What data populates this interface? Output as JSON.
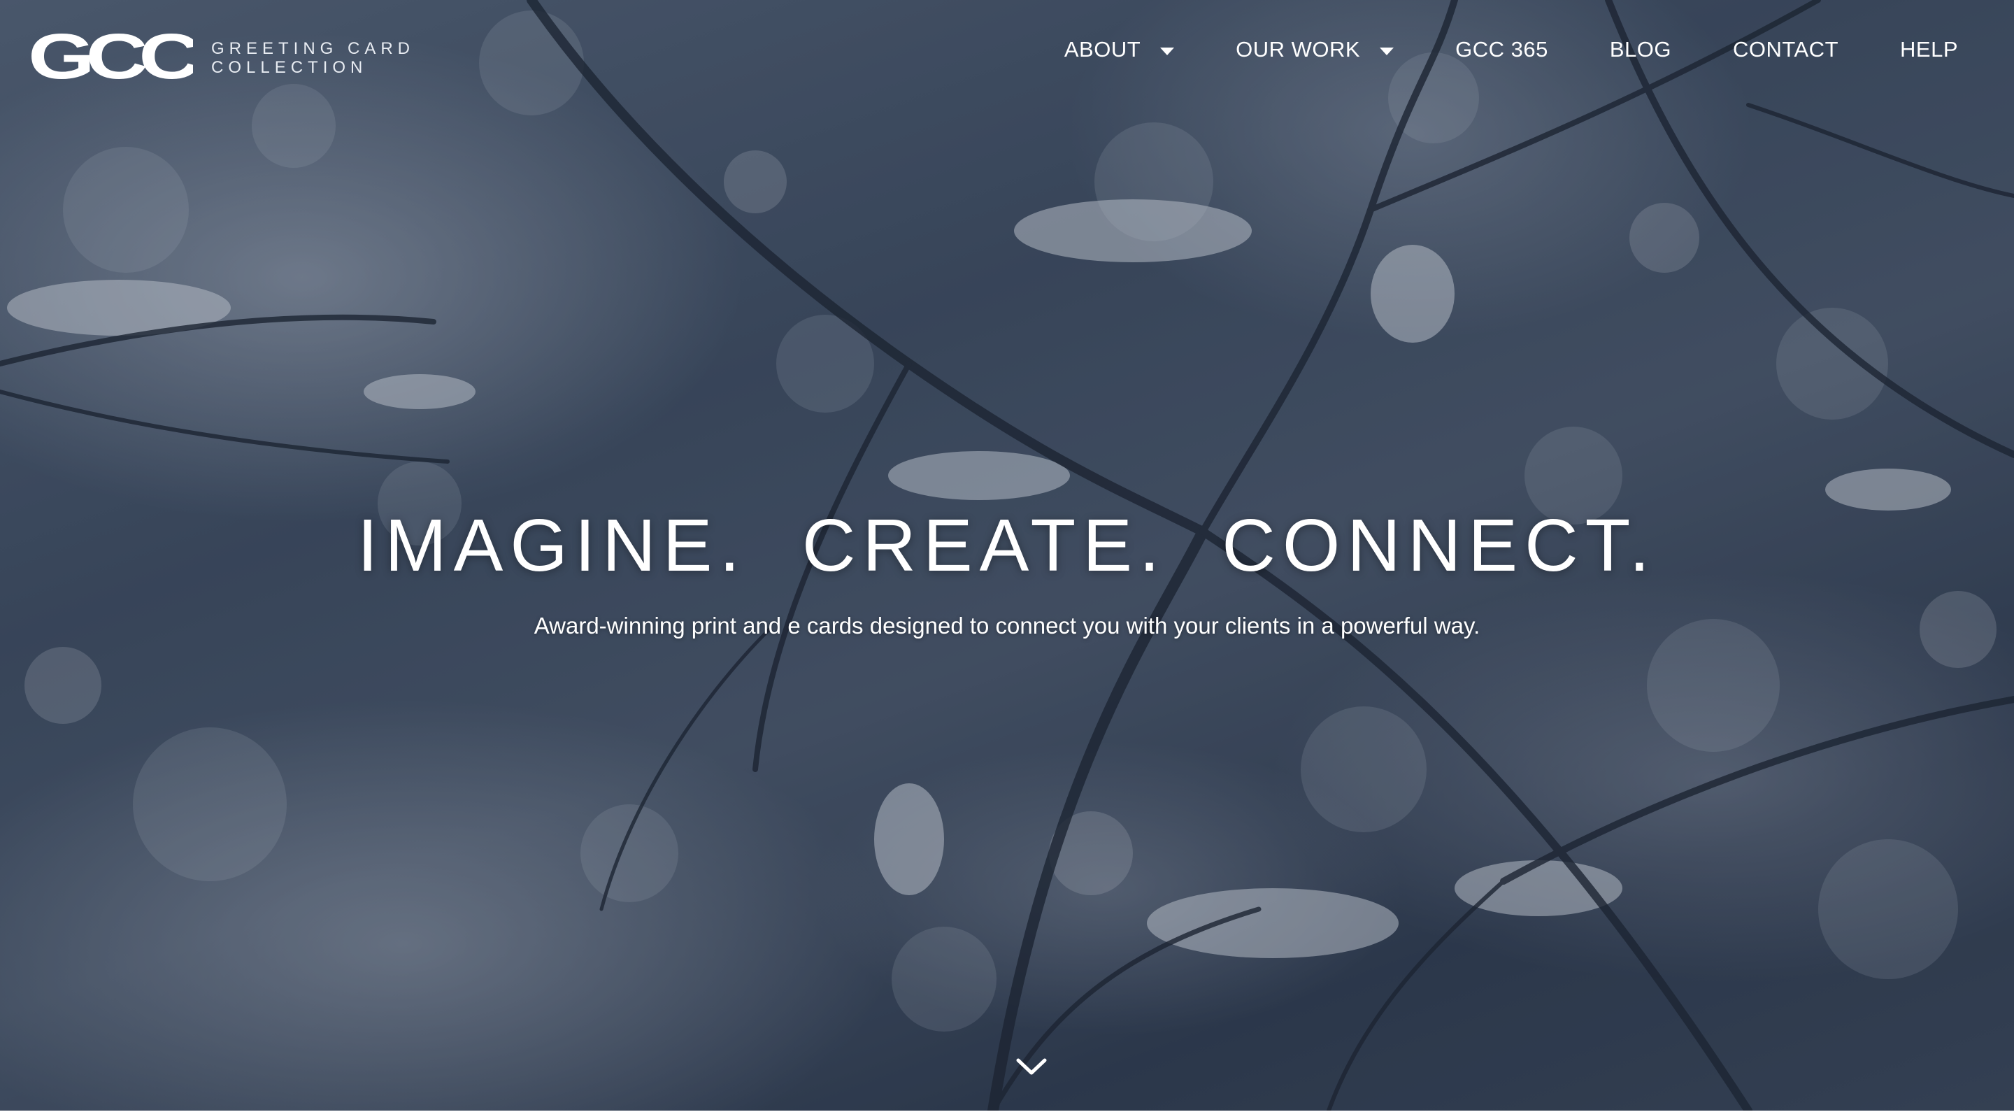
{
  "brand": {
    "mark": "GCC",
    "name_line1": "GREETING CARD",
    "name_line2": "COLLECTION"
  },
  "nav": {
    "items": [
      {
        "label": "ABOUT",
        "has_dropdown": true
      },
      {
        "label": "OUR WORK",
        "has_dropdown": true
      },
      {
        "label": "GCC 365",
        "has_dropdown": false
      },
      {
        "label": "BLOG",
        "has_dropdown": false
      },
      {
        "label": "CONTACT",
        "has_dropdown": false
      },
      {
        "label": "HELP",
        "has_dropdown": false
      }
    ]
  },
  "hero": {
    "headline_words": [
      "IMAGINE.",
      "CREATE.",
      "CONNECT."
    ],
    "subheadline": "Award-winning print and e cards designed to connect you with your clients in a powerful way.",
    "background_description_icon": "snowy-branches-image",
    "scroll_icon": "chevron-down-icon"
  },
  "colors": {
    "text": "#ffffff",
    "overlay": "#1e2634",
    "bg_dark": "#2f3d52",
    "bg_light": "#55657b"
  }
}
